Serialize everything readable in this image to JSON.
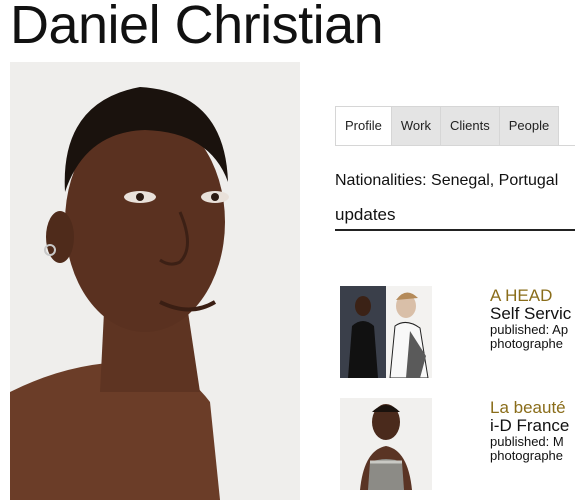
{
  "model": {
    "name": "Daniel Christian"
  },
  "tabs": [
    {
      "label": "Profile",
      "active": true
    },
    {
      "label": "Work",
      "active": false
    },
    {
      "label": "Clients",
      "active": false
    },
    {
      "label": "People",
      "active": false
    }
  ],
  "profile": {
    "nationalities": "Nationalities: Senegal, Portugal"
  },
  "updates": {
    "heading": "updates",
    "items": [
      {
        "title": "A HEAD",
        "publication": "Self Servic",
        "published": "published: Ap",
        "photographer": "photographe"
      },
      {
        "title": "La beauté",
        "publication": "i-D France",
        "published": "published: M",
        "photographer": "photographe"
      }
    ]
  },
  "colors": {
    "accent": "#8a6d1a",
    "tab_bg": "#e4e4e4",
    "portrait_bg": "#f0efed"
  }
}
